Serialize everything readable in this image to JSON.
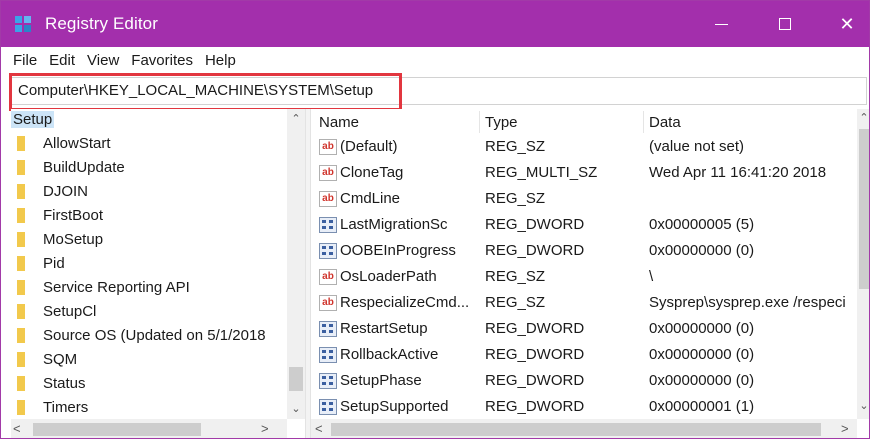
{
  "window": {
    "title": "Registry Editor",
    "accent_color": "#a32fac",
    "minimize_icon": "minimize-icon",
    "maximize_icon": "maximize-icon",
    "close_glyph": "✕"
  },
  "menu": [
    "File",
    "Edit",
    "View",
    "Favorites",
    "Help"
  ],
  "address": {
    "path": "Computer\\HKEY_LOCAL_MACHINE\\SYSTEM\\Setup",
    "highlight_color": "#e2363f"
  },
  "tree": {
    "selected": "Setup",
    "items": [
      "AllowStart",
      "BuildUpdate",
      "DJOIN",
      "FirstBoot",
      "MoSetup",
      "Pid",
      "Service Reporting API",
      "SetupCl",
      "Source OS (Updated on 5/1/2018",
      "SQM",
      "Status",
      "Timers"
    ]
  },
  "values": {
    "columns": [
      "Name",
      "Type",
      "Data"
    ],
    "rows": [
      {
        "icon": "string-value-icon",
        "name": "(Default)",
        "type": "REG_SZ",
        "data": "(value not set)"
      },
      {
        "icon": "string-value-icon",
        "name": "CloneTag",
        "type": "REG_MULTI_SZ",
        "data": "Wed Apr 11 16:41:20 2018"
      },
      {
        "icon": "string-value-icon",
        "name": "CmdLine",
        "type": "REG_SZ",
        "data": ""
      },
      {
        "icon": "binary-value-icon",
        "name": "LastMigrationSc",
        "type": "REG_DWORD",
        "data": "0x00000005 (5)"
      },
      {
        "icon": "binary-value-icon",
        "name": "OOBEInProgress",
        "type": "REG_DWORD",
        "data": "0x00000000 (0)"
      },
      {
        "icon": "string-value-icon",
        "name": "OsLoaderPath",
        "type": "REG_SZ",
        "data": "\\"
      },
      {
        "icon": "string-value-icon",
        "name": "RespecializeCmd...",
        "type": "REG_SZ",
        "data": "Sysprep\\sysprep.exe /respeci"
      },
      {
        "icon": "binary-value-icon",
        "name": "RestartSetup",
        "type": "REG_DWORD",
        "data": "0x00000000 (0)"
      },
      {
        "icon": "binary-value-icon",
        "name": "RollbackActive",
        "type": "REG_DWORD",
        "data": "0x00000000 (0)"
      },
      {
        "icon": "binary-value-icon",
        "name": "SetupPhase",
        "type": "REG_DWORD",
        "data": "0x00000000 (0)"
      },
      {
        "icon": "binary-value-icon",
        "name": "SetupSupported",
        "type": "REG_DWORD",
        "data": "0x00000001 (1)"
      }
    ]
  },
  "icons": {
    "string_value_glyph": "ab",
    "folder": "folder-icon",
    "scroll_up": "▲",
    "scroll_down": "▼",
    "scroll_left": "<",
    "scroll_right": ">",
    "tree_scroll_up": "⌃",
    "tree_scroll_down": "⌄"
  }
}
